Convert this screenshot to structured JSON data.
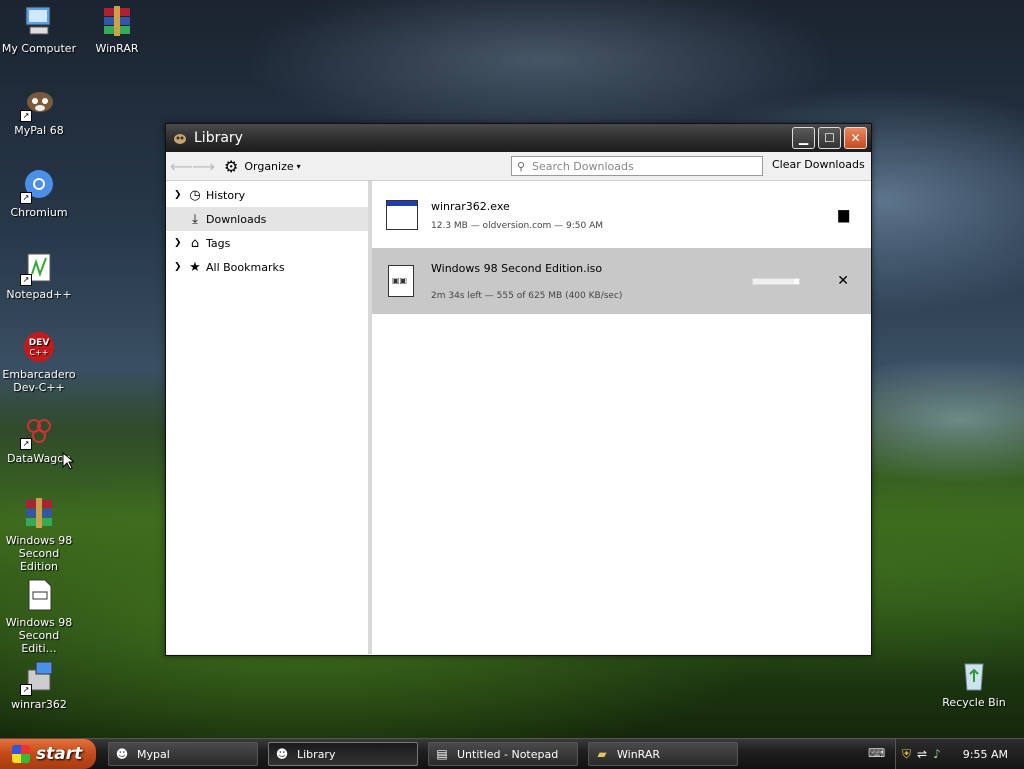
{
  "desktop": {
    "icons": [
      {
        "label": "My Computer",
        "icon": "computer-icon"
      },
      {
        "label": "WinRAR",
        "icon": "winrar-icon"
      },
      {
        "label": "MyPal 68",
        "icon": "mypal-icon"
      },
      {
        "label": "Chromium",
        "icon": "chromium-icon"
      },
      {
        "label": "Notepad++",
        "icon": "notepadpp-icon"
      },
      {
        "label": "Embarcadero Dev-C++",
        "icon": "devcpp-icon"
      },
      {
        "label": "DataWagon",
        "icon": "datawagon-icon"
      },
      {
        "label": "Windows 98 Second Edition",
        "icon": "winrar-archive-icon"
      },
      {
        "label": "Windows 98 Second Editi…",
        "icon": "iso-file-icon"
      },
      {
        "label": "winrar362",
        "icon": "installer-icon"
      },
      {
        "label": "Recycle Bin",
        "icon": "recycle-bin-icon"
      }
    ]
  },
  "window": {
    "title": "Library",
    "toolbar": {
      "organize_label": "Organize",
      "search_placeholder": "Search Downloads",
      "clear_label": "Clear Downloads"
    },
    "sidebar": {
      "items": [
        {
          "label": "History",
          "icon": "clock-icon",
          "expandable": true
        },
        {
          "label": "Downloads",
          "icon": "download-icon",
          "expandable": false,
          "selected": true
        },
        {
          "label": "Tags",
          "icon": "tag-icon",
          "expandable": true
        },
        {
          "label": "All Bookmarks",
          "icon": "star-icon",
          "expandable": true
        }
      ]
    },
    "downloads": [
      {
        "name": "winrar362.exe",
        "status": "12.3 MB — oldversion.com — 9:50 AM",
        "action": "open-folder"
      },
      {
        "name": "Windows 98 Second Edition.iso",
        "status": "2m 34s left — 555 of 625 MB (400 KB/sec)",
        "action": "cancel",
        "progress": 0.888
      }
    ]
  },
  "taskbar": {
    "start_label": "start",
    "tasks": [
      {
        "label": "Mypal",
        "icon": "mypal-icon",
        "active": false
      },
      {
        "label": "Library",
        "icon": "library-icon",
        "active": true
      },
      {
        "label": "Untitled - Notepad",
        "icon": "notepad-icon",
        "active": false
      },
      {
        "label": "WinRAR",
        "icon": "folder-icon",
        "active": false
      }
    ],
    "clock": "9:55 AM"
  },
  "colors": {
    "titlebar": "#2b2b2b",
    "start_button": "#c24a1a",
    "selection": "#c8c8c8"
  }
}
